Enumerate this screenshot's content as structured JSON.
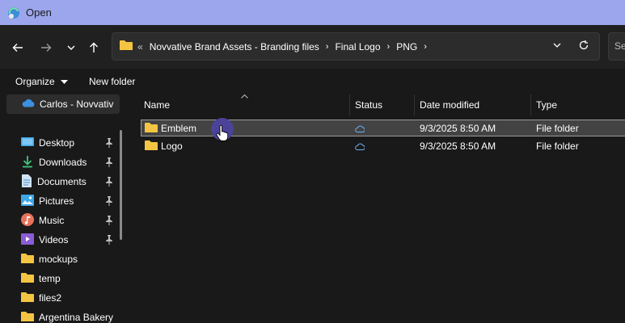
{
  "window": {
    "title": "Open"
  },
  "address": {
    "overflow": "«",
    "crumbs": [
      "Novvative Brand Assets - Branding files",
      "Final Logo",
      "PNG"
    ],
    "separator": "›"
  },
  "search": {
    "placeholder": "Se"
  },
  "commands": {
    "organize": "Organize",
    "new_folder": "New folder"
  },
  "sidebar": {
    "onedrive": "Carlos - Novvativ",
    "items": [
      {
        "label": "Desktop",
        "icon": "desktop-icon",
        "pinned": true
      },
      {
        "label": "Downloads",
        "icon": "download-icon",
        "pinned": true
      },
      {
        "label": "Documents",
        "icon": "documents-icon",
        "pinned": true
      },
      {
        "label": "Pictures",
        "icon": "pictures-icon",
        "pinned": true
      },
      {
        "label": "Music",
        "icon": "music-icon",
        "pinned": true
      },
      {
        "label": "Videos",
        "icon": "videos-icon",
        "pinned": true
      },
      {
        "label": "mockups",
        "icon": "folder-icon",
        "pinned": false
      },
      {
        "label": "temp",
        "icon": "folder-icon",
        "pinned": false
      },
      {
        "label": "files2",
        "icon": "folder-icon",
        "pinned": false
      },
      {
        "label": "Argentina Bakery",
        "icon": "folder-icon",
        "pinned": false
      }
    ]
  },
  "columns": {
    "name": "Name",
    "status": "Status",
    "date": "Date modified",
    "type": "Type"
  },
  "files": [
    {
      "name": "Emblem",
      "date": "9/3/2025 8:50 AM",
      "type": "File folder",
      "selected": true
    },
    {
      "name": "Logo",
      "date": "9/3/2025 8:50 AM",
      "type": "File folder",
      "selected": false
    }
  ],
  "colors": {
    "titlebar": "#9ba6ec",
    "folder": "#f4c542",
    "cloud": "#6bb3f2",
    "selection": "#434343"
  }
}
